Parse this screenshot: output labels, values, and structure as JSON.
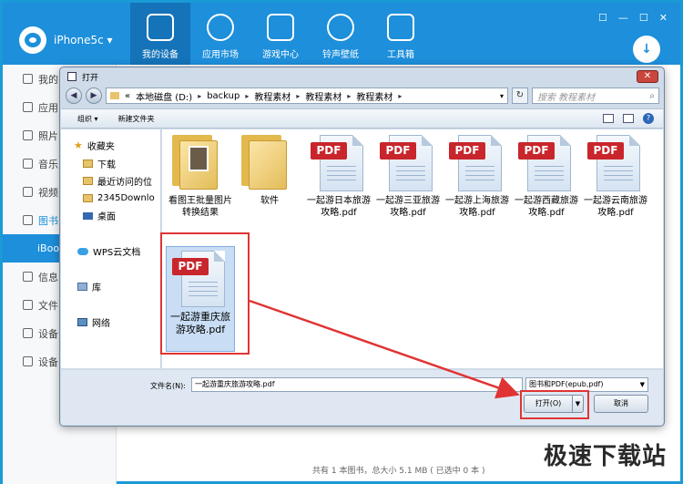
{
  "app": {
    "brand": "iPhone5c ▾",
    "nav": [
      "我的设备",
      "应用市场",
      "游戏中心",
      "铃声壁纸",
      "工具箱"
    ],
    "window_controls": [
      "☐",
      "—",
      "☐",
      "✕"
    ],
    "sidebar": [
      "我的",
      "应用",
      "照片",
      "音乐",
      "视频",
      "图书",
      "iBoo",
      "信息",
      "文件",
      "设备",
      "设备"
    ],
    "status": "共有 1 本图书，总大小 5.1 MB ( 已选中 0 本 )",
    "watermark": "极速下载站"
  },
  "dialog": {
    "title": "打开",
    "close": "✕",
    "address": {
      "back": "◀",
      "forward": "▶",
      "chevrons": "«",
      "segments": [
        "本地磁盘 (D:)",
        "backup",
        "教程素材",
        "教程素材",
        "教程素材"
      ],
      "separator": "▸",
      "dropdown": "▾",
      "refresh": "↻"
    },
    "search": {
      "placeholder": "搜索 教程素材",
      "icon": "⌕"
    },
    "toolbar": {
      "organize": "组织 ▾",
      "new_folder": "新建文件夹",
      "help": "?"
    },
    "nav_pane": [
      {
        "label": "收藏夹",
        "icon": "star"
      },
      {
        "label": "下载",
        "icon": "folder"
      },
      {
        "label": "最近访问的位",
        "icon": "folder"
      },
      {
        "label": "2345Downlo",
        "icon": "folder"
      },
      {
        "label": "桌面",
        "icon": "desktop"
      },
      {
        "label": "WPS云文档",
        "icon": "cloud"
      },
      {
        "label": "库",
        "icon": "library"
      },
      {
        "label": "网络",
        "icon": "network"
      }
    ],
    "files": [
      {
        "name": "看图王批量图片转换结果",
        "type": "folder"
      },
      {
        "name": "软件",
        "type": "folder"
      },
      {
        "name": "一起游日本旅游攻略.pdf",
        "type": "pdf"
      },
      {
        "name": "一起游三亚旅游攻略.pdf",
        "type": "pdf"
      },
      {
        "name": "一起游上海旅游攻略.pdf",
        "type": "pdf"
      },
      {
        "name": "一起游西藏旅游攻略.pdf",
        "type": "pdf"
      },
      {
        "name": "一起游云南旅游攻略.pdf",
        "type": "pdf"
      },
      {
        "name": "一起游重庆旅游攻略.pdf",
        "type": "pdf",
        "selected": true
      }
    ],
    "pdf_badge": "PDF",
    "filename_label": "文件名(N):",
    "filename_value": "一起游重庆旅游攻略.pdf",
    "filetype": "图书和PDF(epub,pdf)",
    "open_button": "打开(O)",
    "cancel_button": "取消"
  },
  "colors": {
    "accent": "#1d8fdb",
    "highlight": "#e03434",
    "pdf_red": "#c8262c"
  }
}
